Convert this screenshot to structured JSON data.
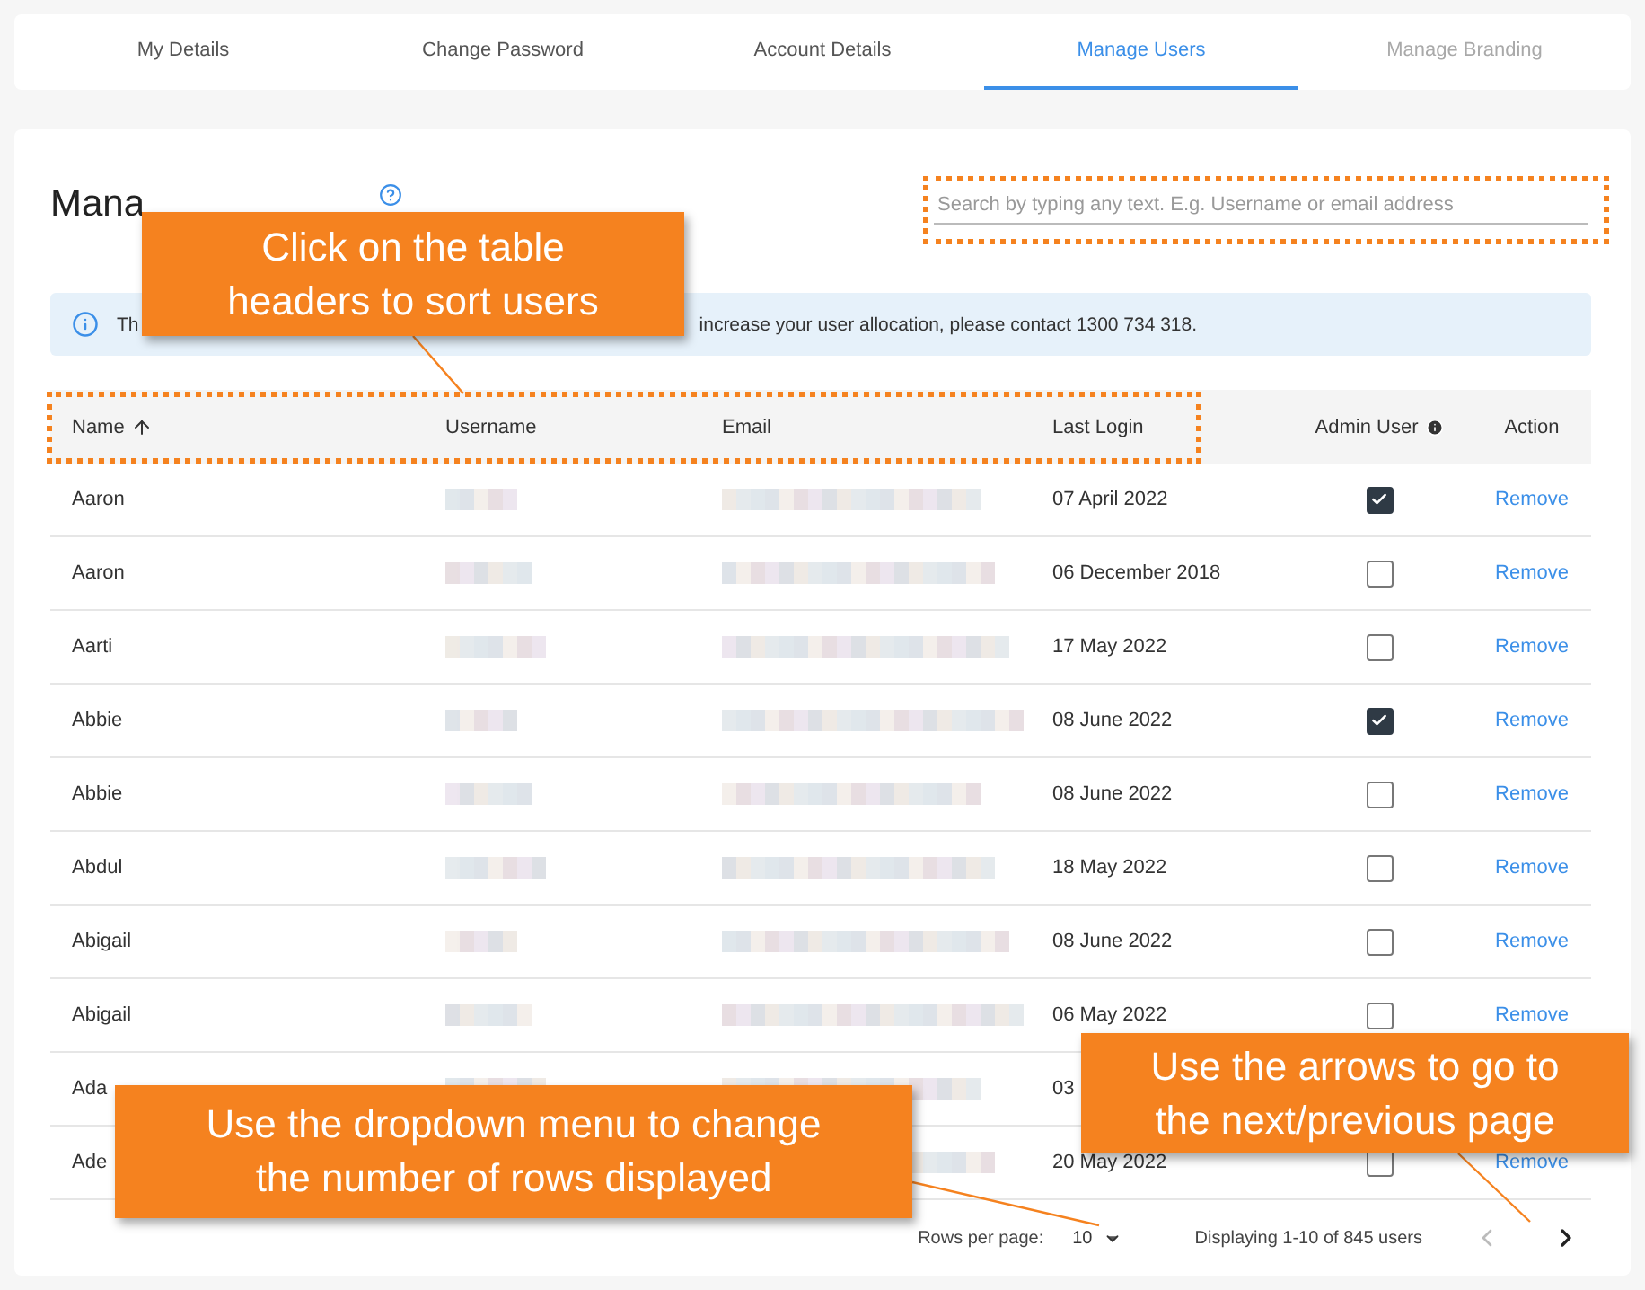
{
  "tabs": [
    {
      "label": "My Details",
      "selected": false,
      "disabled": false
    },
    {
      "label": "Change Password",
      "selected": false,
      "disabled": false
    },
    {
      "label": "Account Details",
      "selected": false,
      "disabled": false
    },
    {
      "label": "Manage Users",
      "selected": true,
      "disabled": false
    },
    {
      "label": "Manage Branding",
      "selected": false,
      "disabled": true
    }
  ],
  "title": "Mana",
  "search": {
    "placeholder": "Search by typing any text. E.g. Username or email address"
  },
  "info_banner": {
    "text_start": "Th",
    "text_end": "increase your user allocation, please contact 1300 734 318."
  },
  "table": {
    "columns": [
      {
        "label": "Name",
        "sorted": true
      },
      {
        "label": "Username",
        "sorted": false
      },
      {
        "label": "Email",
        "sorted": false
      },
      {
        "label": "Last Login",
        "sorted": false
      },
      {
        "label": "Admin User",
        "sorted": false
      },
      {
        "label": "Action",
        "sorted": false
      }
    ],
    "rows": [
      {
        "name": "Aaron",
        "last_login": "07 April 2022",
        "admin": true,
        "action": "Remove"
      },
      {
        "name": "Aaron",
        "last_login": "06 December 2018",
        "admin": false,
        "action": "Remove"
      },
      {
        "name": "Aarti",
        "last_login": "17 May 2022",
        "admin": false,
        "action": "Remove"
      },
      {
        "name": "Abbie",
        "last_login": "08 June 2022",
        "admin": true,
        "action": "Remove"
      },
      {
        "name": "Abbie",
        "last_login": "08 June 2022",
        "admin": false,
        "action": "Remove"
      },
      {
        "name": "Abdul",
        "last_login": "18 May 2022",
        "admin": false,
        "action": "Remove"
      },
      {
        "name": "Abigail",
        "last_login": "08 June 2022",
        "admin": false,
        "action": "Remove"
      },
      {
        "name": "Abigail",
        "last_login": "06 May 2022",
        "admin": false,
        "action": "Remove"
      },
      {
        "name": "Ada",
        "last_login": "03"
      },
      {
        "name": "Ade",
        "last_login": "20 May 2022",
        "admin": false,
        "action": "Remove"
      }
    ]
  },
  "pagination": {
    "rows_label": "Rows per page:",
    "rows_value": "10",
    "summary": "Displaying 1-10 of 845 users",
    "prev_disabled": true,
    "next_disabled": false
  },
  "callouts": [
    {
      "text": "Click on the table headers to sort users"
    },
    {
      "text": "Use the dropdown menu to change the number of rows displayed"
    },
    {
      "text": "Use the arrows to go to the next/previous page"
    }
  ]
}
